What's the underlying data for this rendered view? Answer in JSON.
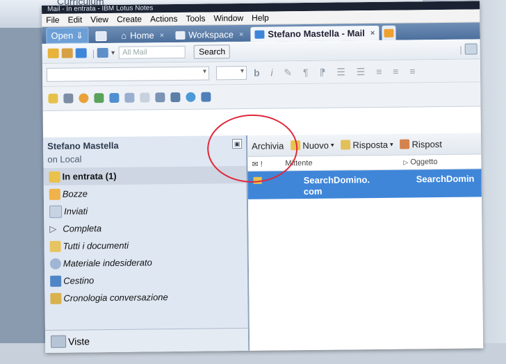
{
  "backdrop": {
    "ghost_title": "Curriculum"
  },
  "window": {
    "title": "Mail - In entrata - IBM Lotus Notes",
    "menu": [
      "File",
      "Edit",
      "View",
      "Create",
      "Actions",
      "Tools",
      "Window",
      "Help"
    ],
    "tabs": [
      {
        "label": "Open"
      },
      {
        "label": "Home"
      },
      {
        "label": "Workspace"
      },
      {
        "label": "Stefano Mastella - Mail"
      }
    ]
  },
  "toolbar": {
    "all_mail_placeholder": "All Mail",
    "search_label": "Search"
  },
  "nav": {
    "header": "Stefano Mastella",
    "subheader": "on Local",
    "items": [
      {
        "label": "In entrata (1)",
        "icon": "inbox-icon"
      },
      {
        "label": "Bozze",
        "icon": "drafts-icon"
      },
      {
        "label": "Inviati",
        "icon": "sent-icon"
      },
      {
        "label": "Completa",
        "icon": "flag-icon"
      },
      {
        "label": "Tutti i documenti",
        "icon": "all-documents-icon"
      },
      {
        "label": "Materiale indesiderato",
        "icon": "junk-icon"
      },
      {
        "label": "Cestino",
        "icon": "trash-icon"
      },
      {
        "label": "Cronologia conversazione",
        "icon": "conversation-icon"
      }
    ],
    "views_label": "Viste"
  },
  "actions": {
    "archive": "Archivia",
    "new": "Nuovo",
    "reply": "Risposta",
    "reply_all": "Rispost"
  },
  "columns": {
    "sender": "Mittente",
    "subject": "Oggetto"
  },
  "messages": [
    {
      "sender": "SearchDomino.",
      "sender2": "com",
      "subject": "SearchDomin"
    }
  ],
  "colors": {
    "accent": "#3f86d9",
    "highlight_circle": "#e0283a",
    "tab_bar": "#5a7daa"
  }
}
